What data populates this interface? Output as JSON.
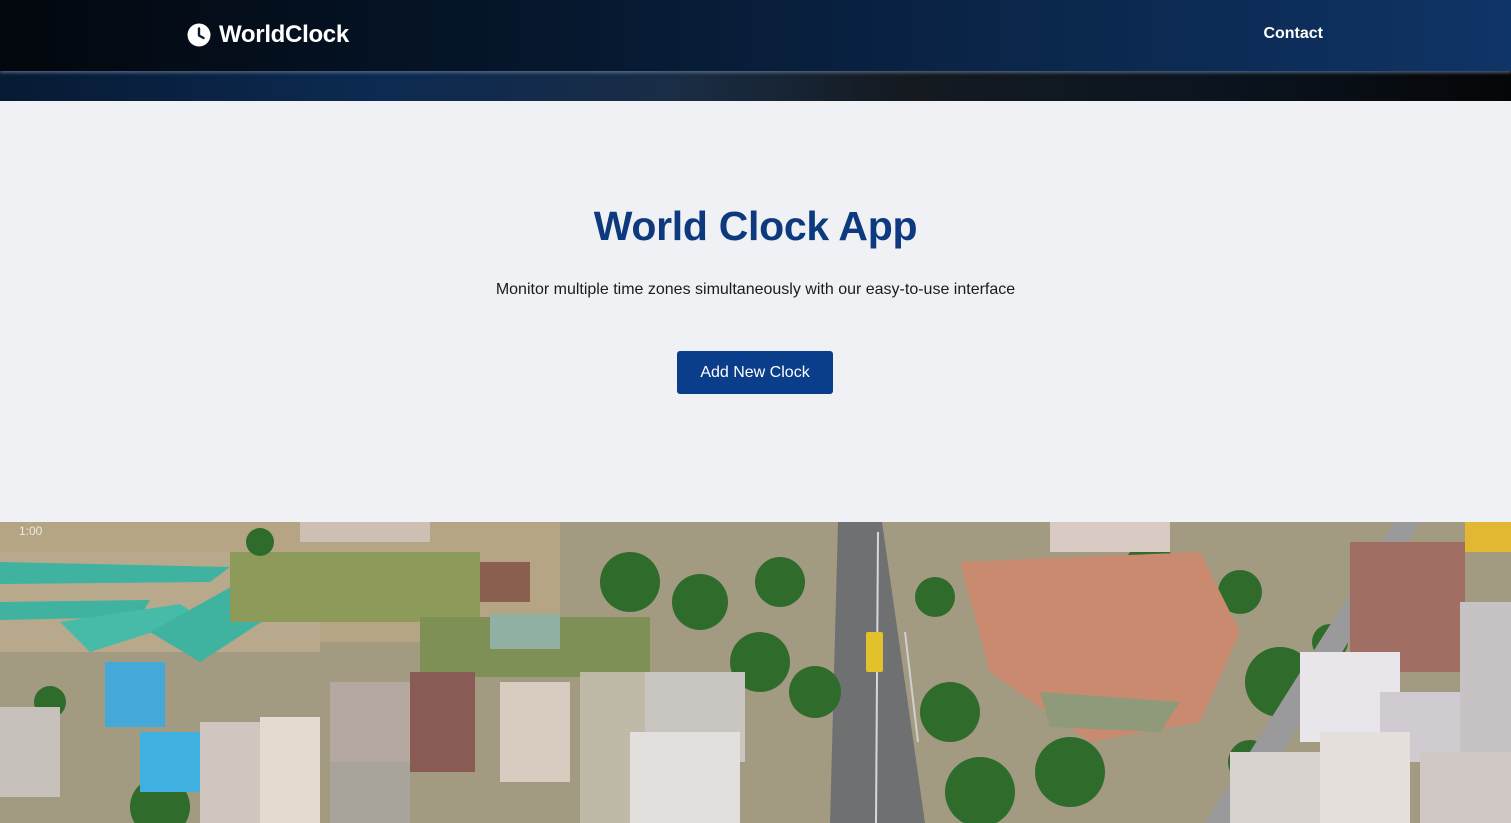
{
  "nav": {
    "brand_name": "WorldClock",
    "brand_icon": "clock-icon",
    "contact_label": "Contact"
  },
  "hero": {
    "title": "World Clock App",
    "subtitle": "Monitor multiple time zones simultaneously with our easy-to-use interface",
    "button_label": "Add New Clock"
  },
  "video": {
    "timestamp": "1:00"
  },
  "colors": {
    "accent": "#0b3e8a",
    "title": "#0d3a7e",
    "nav_dark": "#03070d",
    "nav_light": "#0f3466",
    "page_bg": "#f0f1f4"
  }
}
